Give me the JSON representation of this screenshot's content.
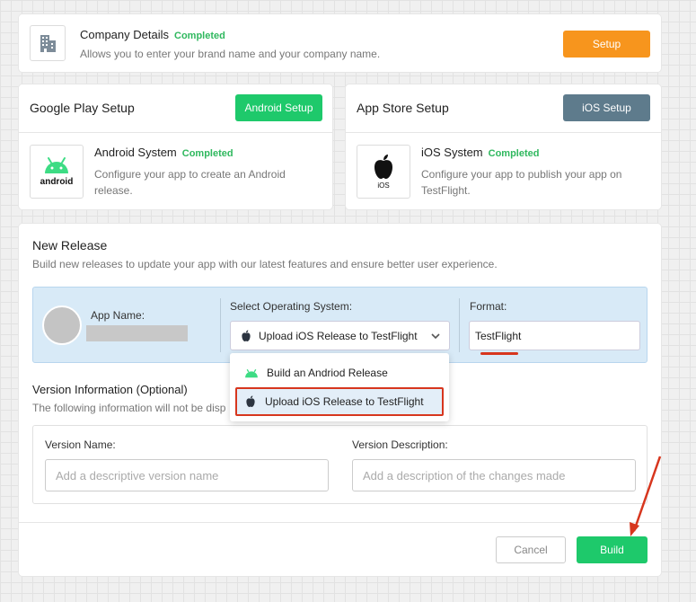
{
  "company": {
    "title": "Company Details",
    "status": "Completed",
    "description": "Allows you to enter your brand name and your company name.",
    "setup_label": "Setup"
  },
  "google_play": {
    "title": "Google Play Setup",
    "button_label": "Android Setup",
    "system_title": "Android System",
    "status": "Completed",
    "description_line1": "Configure your app to create an Android",
    "description_line2": "release.",
    "logo_text": "android"
  },
  "app_store": {
    "title": "App Store Setup",
    "button_label": "iOS Setup",
    "system_title": "iOS System",
    "status": "Completed",
    "description_line1": "Configure your app to publish your app on",
    "description_line2": "TestFlight.",
    "logo_text": "iOS"
  },
  "release": {
    "title": "New Release",
    "description": "Build new releases to update your app with our latest features and ensure better user experience.",
    "app_name_label": "App Name:",
    "os_label": "Select Operating System:",
    "os_selected": "Upload iOS Release to TestFlight",
    "format_label": "Format:",
    "format_value": "TestFlight",
    "dropdown": [
      {
        "label": "Build an Andriod Release",
        "icon": "android-icon"
      },
      {
        "label": "Upload iOS Release to TestFlight",
        "icon": "apple-icon"
      }
    ],
    "version_title": "Version Information (Optional)",
    "version_desc": "The following information will not be disp",
    "version_name_label": "Version Name:",
    "version_name_placeholder": "Add a descriptive version name",
    "version_desc_label": "Version Description:",
    "version_desc_placeholder": "Add a description of the changes made",
    "cancel_label": "Cancel",
    "build_label": "Build"
  },
  "colors": {
    "orange": "#f7951d",
    "green": "#1ec96b",
    "slate": "#5e7b8c",
    "completed": "#2fb85e",
    "annotation_red": "#d7361e"
  }
}
